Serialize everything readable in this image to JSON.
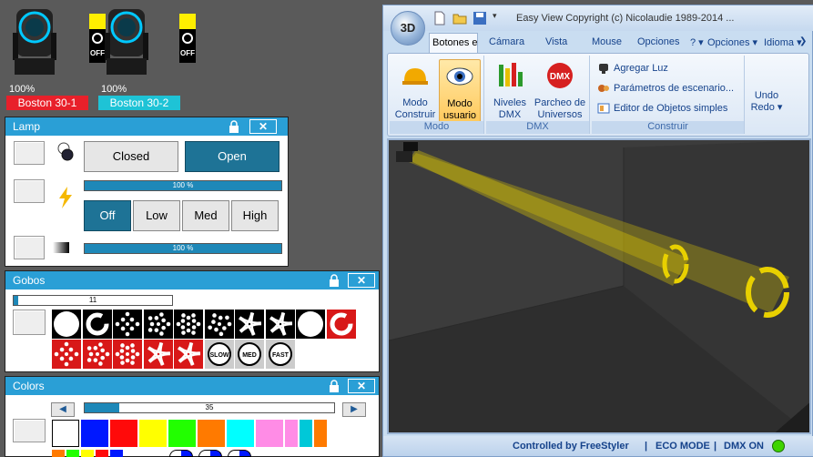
{
  "fixtures": [
    {
      "percent": "100%",
      "name": "Boston 30-1",
      "tag_color": "#e8202a",
      "state": "OFF"
    },
    {
      "percent": "100%",
      "name": "Boston 30-2",
      "tag_color": "#1ec3d6",
      "state": "OFF"
    }
  ],
  "lamp": {
    "title": "Lamp",
    "close": "✕",
    "closed_label": "Closed",
    "open_label": "Open",
    "shutter_state": "Open",
    "intensity_label": "100 %",
    "intensity_level": 1.0,
    "off_label": "Off",
    "low_label": "Low",
    "med_label": "Med",
    "high_label": "High",
    "power_state": "Off",
    "dimmer_label": "100 %",
    "dimmer_level": 1.0
  },
  "gobos": {
    "title": "Gobos",
    "close": "✕",
    "value": "11",
    "value_level": 0.03,
    "rotation_labels": [
      "SLOW",
      "MED",
      "FAST"
    ]
  },
  "colors": {
    "title": "Colors",
    "close": "✕",
    "value": "35",
    "value_level": 0.14,
    "swatches": [
      "#ffffff",
      "#0018ff",
      "#ff0a0a",
      "#ffff00",
      "#22ff00",
      "#ff7a00",
      "#00ffff",
      "#ff8ce6",
      "#ff8ce6",
      "#00c8d8",
      "#ff7a00"
    ],
    "bottom_swatches": [
      "#ff7a00",
      "#22ff00",
      "#ffff00",
      "#ff0a0a",
      "#0018ff"
    ]
  },
  "window": {
    "orb_label": "3D",
    "title": "Easy View   Copyright (c) Nicolaudie 1989-2014 ...",
    "tabs": [
      "Botones e",
      "Cámara",
      "Vista",
      "Mouse",
      "Opciones",
      "? ▾",
      "Opciones ▾",
      "Idioma ▾"
    ],
    "groups": {
      "modo": {
        "label": "Modo",
        "construir": "Modo\nConstruir",
        "usuario": "Modo\nusuario"
      },
      "dmx": {
        "label": "DMX",
        "niveles": "Niveles\nDMX",
        "parcheo": "Parcheo de\nUniversos",
        "dmx_icon": "DMX"
      },
      "construir": {
        "label": "Construir",
        "agregar": "Agregar Luz",
        "parametros": "Parámetros de escenario...",
        "editor": "Editor de Objetos simples"
      },
      "undo": {
        "undo": "Undo",
        "redo": "Redo ▾"
      }
    },
    "status": {
      "controlled": "Controlled by FreeStyler",
      "sep1": "|",
      "eco": "ECO MODE",
      "sep2": "|",
      "dmx": "DMX ON",
      "dmx_color": "#3fd400"
    }
  }
}
